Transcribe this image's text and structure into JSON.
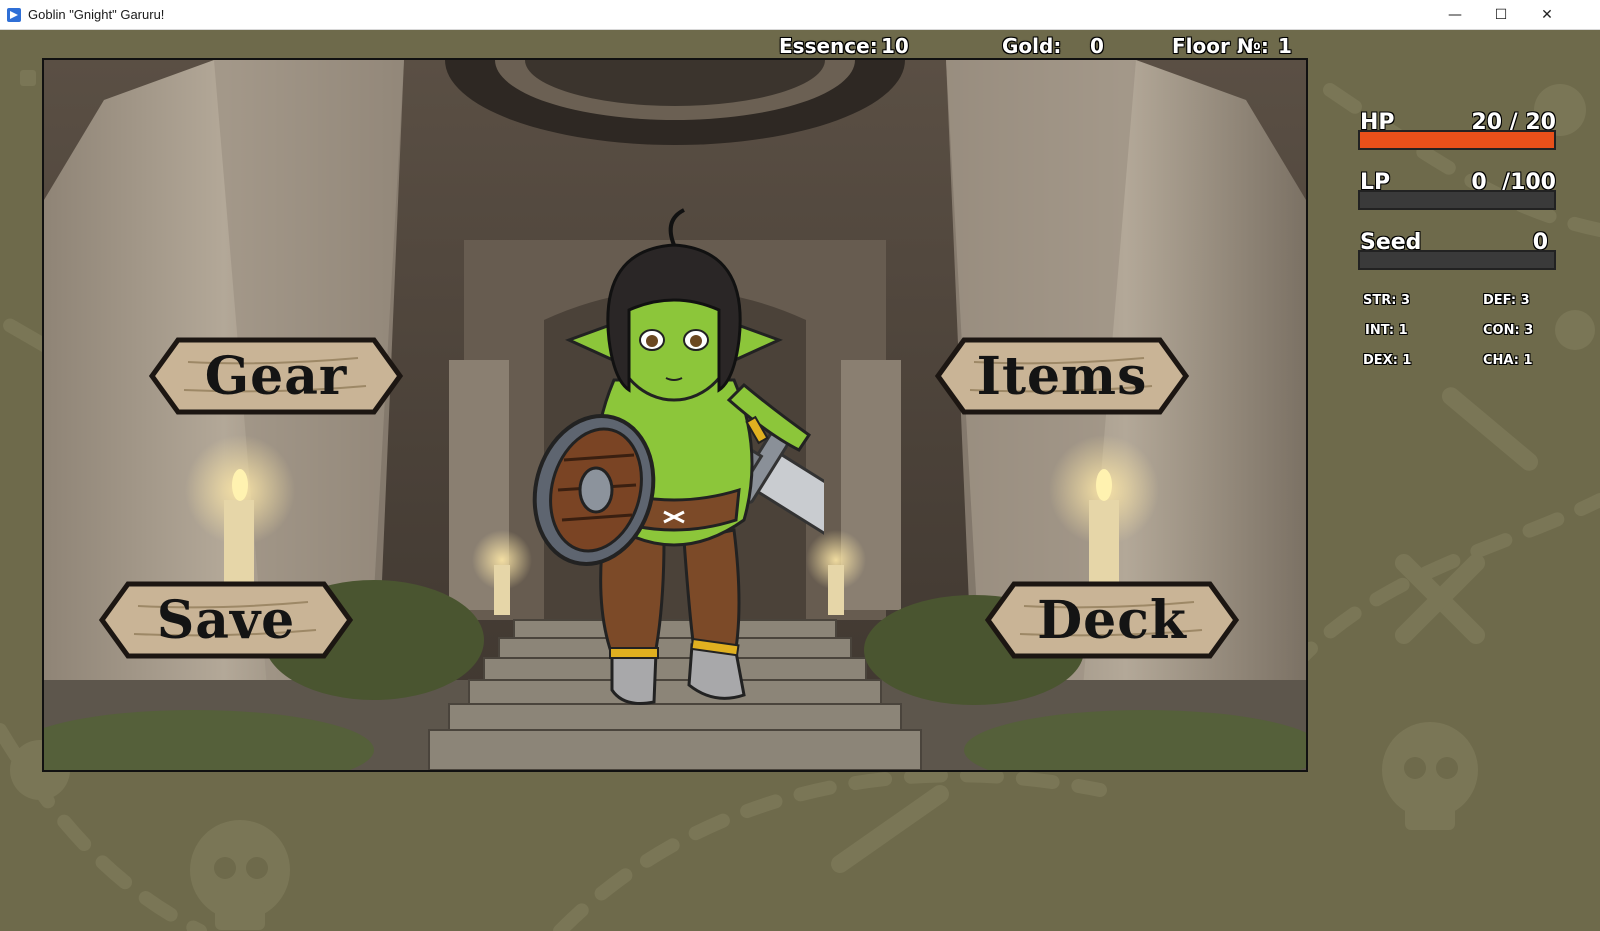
{
  "window": {
    "title": "Goblin \"Gnight\" Garuru!",
    "minimize_glyph": "—",
    "maximize_glyph": "☐",
    "close_glyph": "✕"
  },
  "top_stats": {
    "essence_label": "Essence:",
    "essence_value": "10",
    "gold_label": "Gold:",
    "gold_value": "0",
    "floor_label": "Floor №:",
    "floor_value": "1"
  },
  "menu": {
    "gear": "Gear",
    "items": "Items",
    "save": "Save",
    "deck": "Deck"
  },
  "bars": {
    "hp": {
      "label": "HP",
      "value_text": "20 / 20",
      "current": 20,
      "max": 20,
      "color": "#e8501a"
    },
    "lp": {
      "label": "LP",
      "value_text": "0  /100",
      "current": 0,
      "max": 100,
      "color": "#9a3ad0"
    },
    "seed": {
      "label": "Seed",
      "value_text": "0",
      "current": 0,
      "max": 1,
      "color": "#4aa04a"
    }
  },
  "attributes": {
    "str": "STR:  3",
    "def": "DEF:  3",
    "int": "INT:  1",
    "con": "CON:  3",
    "dex": "DEX:  1",
    "cha": "CHA:  1"
  },
  "colors": {
    "background": "#6e6a4b",
    "pattern": "#7a7656",
    "goblin_skin": "#8cc63a",
    "sign_wood": "#c9b496"
  }
}
